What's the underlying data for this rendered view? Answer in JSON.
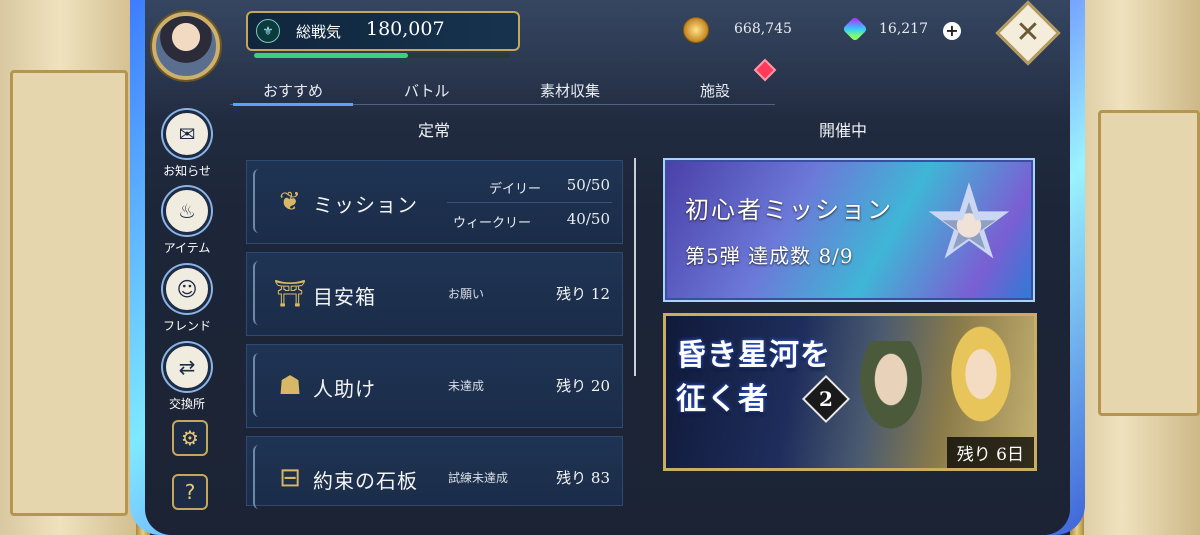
{
  "header": {
    "power_label": "総戦気",
    "power_value": "180,007",
    "power_bar_fill": 0.6,
    "gold": "668,745",
    "gems": "16,217"
  },
  "tabs": [
    {
      "label": "おすすめ",
      "active": true
    },
    {
      "label": "バトル"
    },
    {
      "label": "素材収集"
    },
    {
      "label": "施設"
    }
  ],
  "sections": {
    "regular": "定常",
    "ongoing": "開催中"
  },
  "nav": [
    {
      "label": "お知らせ",
      "icon": "mail-icon"
    },
    {
      "label": "アイテム",
      "icon": "bag-icon"
    },
    {
      "label": "フレンド",
      "icon": "friend-icon"
    },
    {
      "label": "交換所",
      "icon": "exchange-icon"
    }
  ],
  "list": [
    {
      "title": "ミッション",
      "icon": "mission-icon",
      "daily_label": "デイリー",
      "daily_value": "50/50",
      "weekly_label": "ウィークリー",
      "weekly_value": "40/50"
    },
    {
      "title": "目安箱",
      "icon": "suggestion-box-icon",
      "sub": "お願い",
      "remain": "残り 12"
    },
    {
      "title": "人助け",
      "icon": "helping-icon",
      "sub": "未達成",
      "remain": "残り 20"
    },
    {
      "title": "約束の石板",
      "icon": "stone-tablet-icon",
      "sub": "試練未達成",
      "remain": "残り 83"
    }
  ],
  "banners": {
    "beginner": {
      "title": "初心者ミッション",
      "progress": "第5弾 達成数 8/9"
    },
    "event": {
      "title_line1": "昏き星河を",
      "title_line2": "征く者",
      "number": "2",
      "remain": "残り 6日"
    }
  },
  "colors": {
    "accent": "#5aa2ff",
    "gold_frame": "#c6a65a",
    "alert": "#ff3a5a"
  }
}
